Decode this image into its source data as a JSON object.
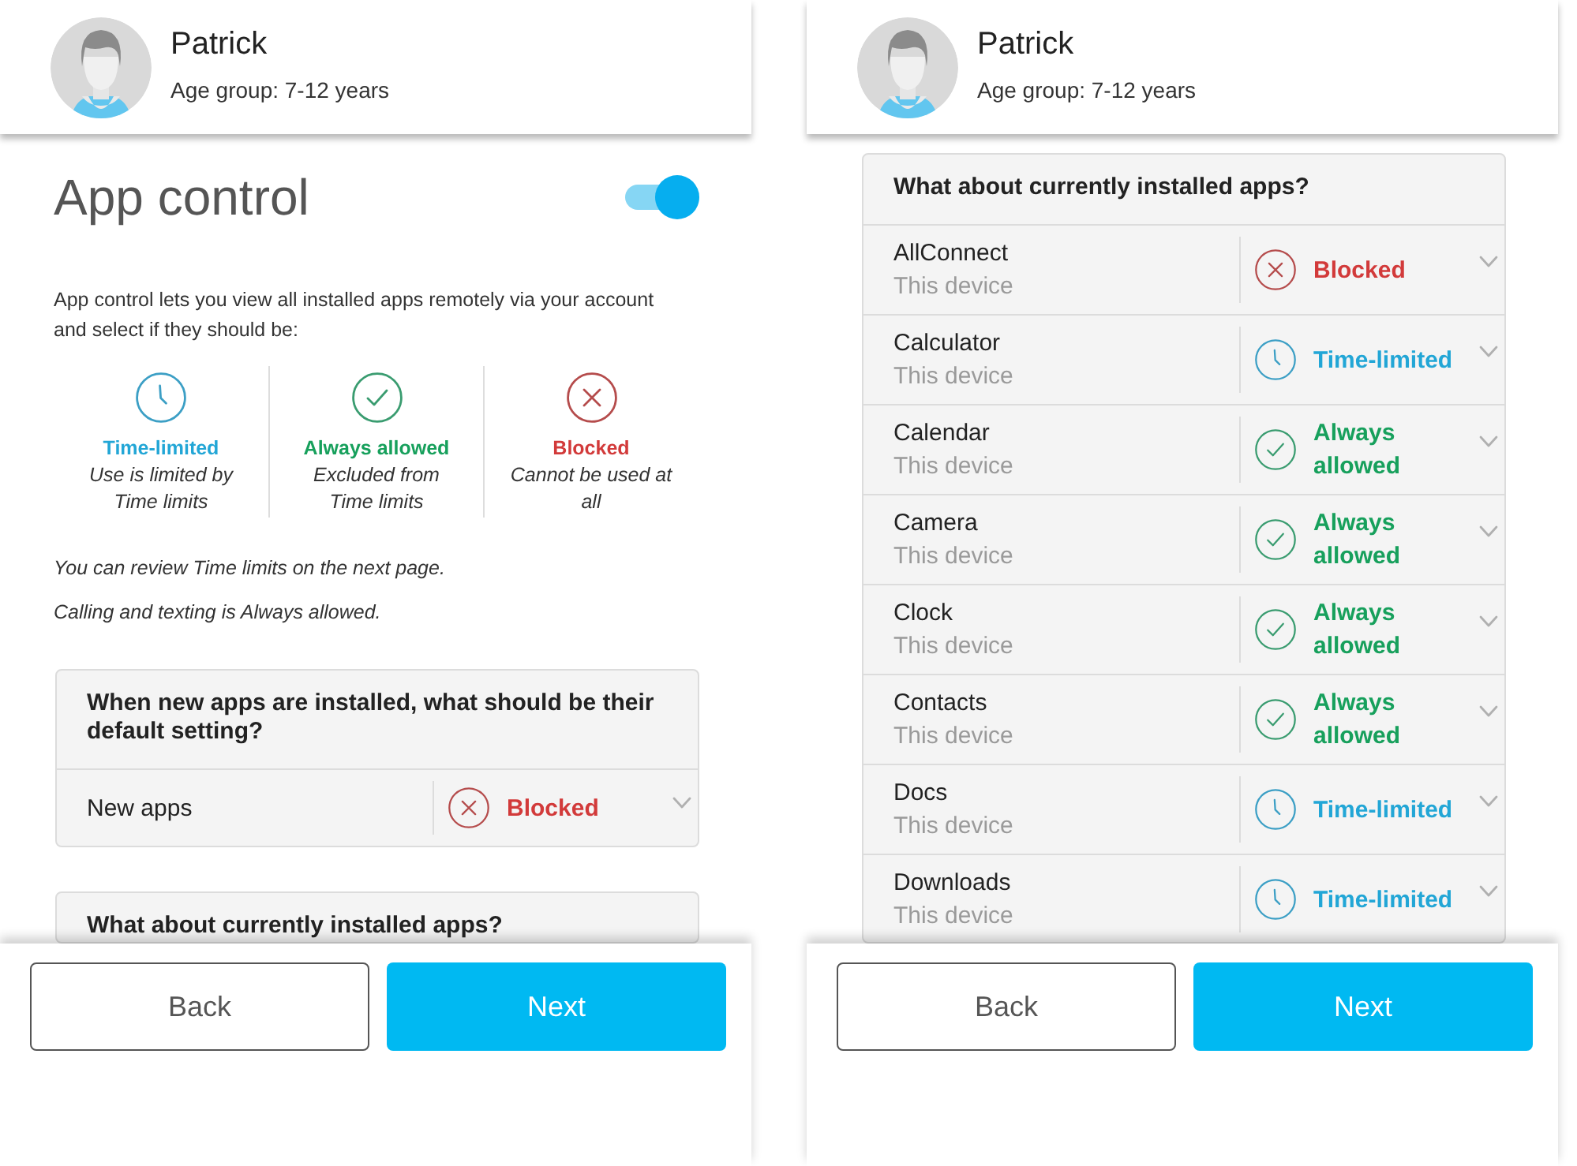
{
  "screens": [
    {
      "profile": {
        "name": "Patrick",
        "age_group": "Age group: 7-12 years"
      },
      "title": "App control",
      "toggle": {
        "on": true
      },
      "intro": "App control lets you view all installed apps remotely via your account and select if they should be:",
      "options": [
        {
          "kind": "time_limited",
          "label": "Time-limited",
          "description": "Use is limited by Time limits"
        },
        {
          "kind": "always_allowed",
          "label": "Always allowed",
          "description": "Excluded from Time limits"
        },
        {
          "kind": "blocked",
          "label": "Blocked",
          "description": "Cannot be used at all"
        }
      ],
      "notes": [
        "You can review Time limits on the next page.",
        "Calling and texting is Always allowed."
      ],
      "cards": [
        {
          "question": "When new apps are installed, what should be their default setting?",
          "rows": [
            {
              "name": "New apps",
              "kind": "blocked",
              "setting": "Blocked"
            }
          ]
        },
        {
          "question": "What about currently installed apps?"
        }
      ],
      "buttons": [
        {
          "kind": "secondary",
          "label": "Back"
        },
        {
          "kind": "primary",
          "label": "Next"
        }
      ]
    },
    {
      "profile": {
        "name": "Patrick",
        "age_group": "Age group: 7-12 years"
      },
      "cards": [
        {
          "question": "What about currently installed apps?",
          "rows": [
            {
              "name": "AllConnect",
              "device": "This device",
              "kind": "blocked",
              "setting": "Blocked"
            },
            {
              "name": "Calculator",
              "device": "This device",
              "kind": "time_limited",
              "setting": "Time-limited"
            },
            {
              "name": "Calendar",
              "device": "This device",
              "kind": "always_allowed",
              "setting": "Always allowed"
            },
            {
              "name": "Camera",
              "device": "This device",
              "kind": "always_allowed",
              "setting": "Always allowed"
            },
            {
              "name": "Clock",
              "device": "This device",
              "kind": "always_allowed",
              "setting": "Always allowed"
            },
            {
              "name": "Contacts",
              "device": "This device",
              "kind": "always_allowed",
              "setting": "Always allowed"
            },
            {
              "name": "Docs",
              "device": "This device",
              "kind": "time_limited",
              "setting": "Time-limited"
            },
            {
              "name": "Downloads",
              "device": "This device",
              "kind": "time_limited",
              "setting": "Time-limited"
            }
          ]
        }
      ],
      "buttons": [
        {
          "kind": "secondary",
          "label": "Back"
        },
        {
          "kind": "primary",
          "label": "Next"
        }
      ]
    }
  ]
}
